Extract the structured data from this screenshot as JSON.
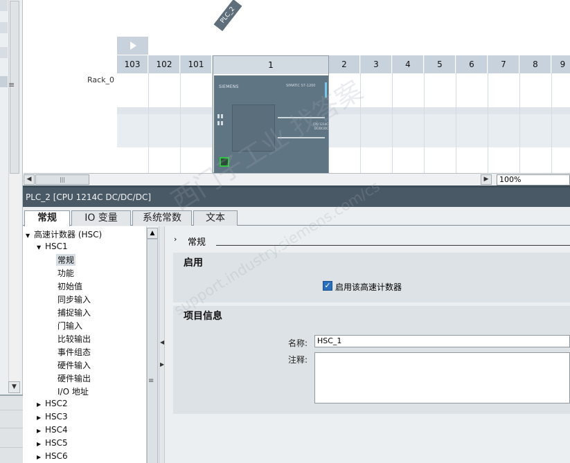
{
  "device_view": {
    "device_tag": "PLC_2",
    "rack_label": "Rack_0",
    "slots": [
      "103",
      "102",
      "101",
      "1",
      "2",
      "3",
      "4",
      "5",
      "6",
      "7",
      "8",
      "9"
    ],
    "cpu": {
      "brand": "SIEMENS",
      "model": "SIMATIC S7-1200",
      "side_label": "CPU 1214C DC/DC/DC"
    },
    "zoom": "100%"
  },
  "properties": {
    "title": "PLC_2 [CPU 1214C DC/DC/DC]",
    "tabs": [
      "常规",
      "IO 变量",
      "系统常数",
      "文本"
    ],
    "active_tab": "常规",
    "nav": {
      "root": "高速计数器 (HSC)",
      "hsc1": "HSC1",
      "hsc1_children": [
        "常规",
        "功能",
        "初始值",
        "同步输入",
        "捕捉输入",
        "门输入",
        "比较输出",
        "事件组态",
        "硬件输入",
        "硬件输出",
        "I/O 地址"
      ],
      "selected": "常规",
      "collapsed": [
        "HSC2",
        "HSC3",
        "HSC4",
        "HSC5",
        "HSC6"
      ]
    },
    "content": {
      "section": "常规",
      "enable_group": {
        "title": "启用",
        "checkbox_label": "启用该高速计数器",
        "checked": true
      },
      "project_group": {
        "title": "项目信息",
        "name_label": "名称:",
        "name_value": "HSC_1",
        "comment_label": "注释:",
        "comment_value": ""
      }
    }
  },
  "watermark": {
    "line1": "西门子工业  找答案",
    "line2": "support.industry.siemens.com/cs"
  },
  "colors": {
    "header_bar": "#4a5966",
    "slot_header": "#c8d2dc",
    "cpu_body": "#607583",
    "checkbox": "#2a6fbd"
  }
}
